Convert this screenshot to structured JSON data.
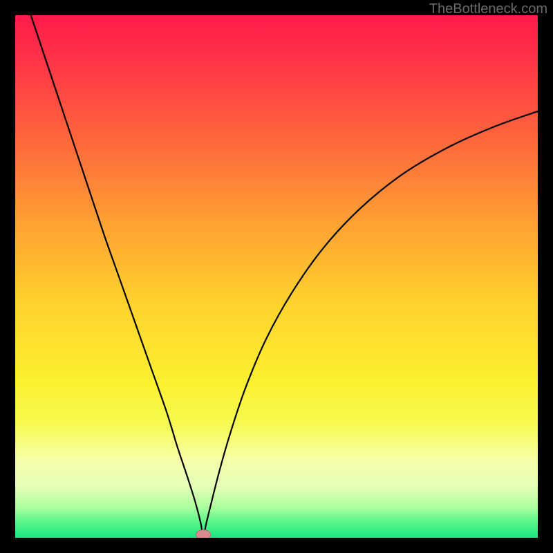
{
  "watermark": "TheBottleneck.com",
  "colors": {
    "black": "#000000",
    "curve": "#000000",
    "marker_fill": "#d98a8f",
    "marker_stroke": "#c06a72",
    "gradient_stops": [
      {
        "offset": 0.0,
        "color": "#ff1a4a"
      },
      {
        "offset": 0.1,
        "color": "#ff3846"
      },
      {
        "offset": 0.25,
        "color": "#ff6a3b"
      },
      {
        "offset": 0.4,
        "color": "#ffa233"
      },
      {
        "offset": 0.55,
        "color": "#ffd22e"
      },
      {
        "offset": 0.7,
        "color": "#fcf02f"
      },
      {
        "offset": 0.78,
        "color": "#f6fa4f"
      },
      {
        "offset": 0.85,
        "color": "#f6ffa8"
      },
      {
        "offset": 0.9,
        "color": "#e6ffb8"
      },
      {
        "offset": 0.94,
        "color": "#b0ff9f"
      },
      {
        "offset": 0.97,
        "color": "#58f58a"
      },
      {
        "offset": 1.0,
        "color": "#18e880"
      }
    ]
  },
  "chart_data": {
    "type": "line",
    "title": "",
    "xlabel": "",
    "ylabel": "",
    "xlim": [
      0,
      100
    ],
    "ylim": [
      0,
      100
    ],
    "min_point": {
      "x": 36,
      "y": 0
    },
    "series": [
      {
        "name": "bottleneck-curve",
        "x": [
          3,
          5,
          8,
          11,
          14,
          17,
          20,
          23,
          26,
          29,
          31,
          33,
          34.5,
          35.5,
          36,
          36.5,
          37.5,
          39,
          41,
          44,
          48,
          53,
          59,
          66,
          74,
          83,
          92,
          100
        ],
        "y": [
          100,
          94,
          85,
          76,
          67,
          58,
          49.5,
          41,
          32.5,
          24,
          17.5,
          11.5,
          6.7,
          2.8,
          0,
          2.5,
          6.6,
          12.5,
          19.5,
          28.5,
          38,
          47,
          55.5,
          63,
          69.5,
          74.8,
          78.8,
          81.6
        ]
      }
    ],
    "marker": {
      "x": 36,
      "y": 0.6,
      "rx": 1.4,
      "ry": 0.9
    }
  }
}
